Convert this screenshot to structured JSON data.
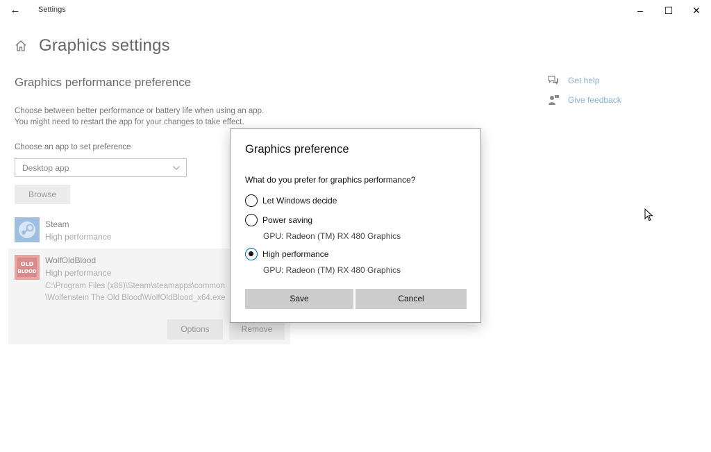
{
  "window": {
    "app_title": "Settings",
    "back_glyph": "←",
    "minimize_glyph": "–",
    "maximize_glyph": "☐",
    "close_glyph": "✕"
  },
  "page": {
    "title": "Graphics settings",
    "section_title": "Graphics performance preference",
    "description_line1": "Choose between better performance or battery life when using an app.",
    "description_line2": "You might need to restart the app for your changes to take effect.",
    "choose_label": "Choose an app to set preference",
    "dropdown_value": "Desktop app",
    "browse_label": "Browse",
    "apps": [
      {
        "name": "Steam",
        "preference": "High performance",
        "icon": "steam-icon"
      },
      {
        "name": "WolfOldBlood",
        "preference": "High performance",
        "path_line1": "C:\\Program Files (x86)\\Steam\\steamapps\\common",
        "path_line2": "\\Wolfenstein The Old Blood\\WolfOldBlood_x64.exe",
        "icon": "wolf-old-blood-icon",
        "icon_text_top": "OLD",
        "icon_text_bottom": "BLOOD",
        "options_label": "Options",
        "remove_label": "Remove"
      }
    ]
  },
  "side_links": {
    "help": "Get help",
    "feedback": "Give feedback"
  },
  "dialog": {
    "title": "Graphics preference",
    "question": "What do you prefer for graphics performance?",
    "options": [
      {
        "label": "Let Windows decide",
        "checked": false
      },
      {
        "label": "Power saving",
        "checked": false,
        "gpu": "GPU: Radeon (TM) RX 480 Graphics"
      },
      {
        "label": "High performance",
        "checked": true,
        "gpu": "GPU: Radeon (TM) RX 480 Graphics"
      }
    ],
    "save_label": "Save",
    "cancel_label": "Cancel"
  },
  "colors": {
    "accent": "#0067c0",
    "link": "#8ab0da",
    "dialog_button": "#cccccc"
  }
}
